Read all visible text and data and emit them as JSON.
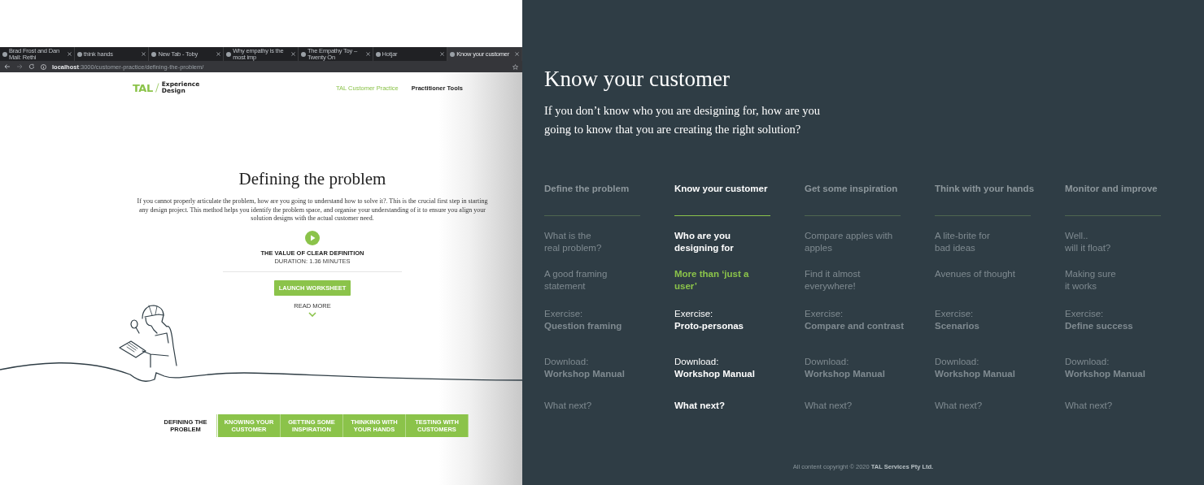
{
  "browser": {
    "tabs": [
      {
        "title": "Brad Frost and Dan Mall: Rethi",
        "selected": false
      },
      {
        "title": "think hands",
        "selected": false
      },
      {
        "title": "New Tab - Toby",
        "selected": false
      },
      {
        "title": "Why empathy is the most imp",
        "selected": false
      },
      {
        "title": "The Empathy Toy – Twenty On",
        "selected": false
      },
      {
        "title": "Hotjar",
        "selected": false
      },
      {
        "title": "Know your customer",
        "selected": true
      }
    ],
    "url": "**localhost**:3000/customer-practice/defining-the-problem/"
  },
  "site": {
    "logo": {
      "mark": "TAL",
      "text": "Experience\nDesign"
    },
    "nav": [
      {
        "label": "TAL Customer Practice",
        "selected": true
      },
      {
        "label": "Practitioner Tools",
        "selected": false
      }
    ],
    "title": "Defining the problem",
    "intro": "If you cannot properly articulate the problem, how are you going to understand how to solve it?. This is the crucial first step in starting any design project. This method helps you identify the problem space, and organise your understanding of it to ensure you align your solution designs with the actual customer need.",
    "video": {
      "title": "THE VALUE OF CLEAR DEFINITION",
      "duration": "DURATION: 1.36 MINUTES"
    },
    "worksheet_button": "LAUNCH WORKSHEET",
    "read_more": "READ MORE",
    "steps": [
      {
        "label": "DEFINING THE\nPROBLEM",
        "selected": true
      },
      {
        "label": "KNOWING YOUR\nCUSTOMER",
        "selected": false
      },
      {
        "label": "GETTING SOME\nINSPIRATION",
        "selected": false
      },
      {
        "label": "THINKING WITH\nYOUR HANDS",
        "selected": false
      },
      {
        "label": "TESTING WITH\nCUSTOMERS",
        "selected": false
      }
    ]
  },
  "panel": {
    "title": "Know your customer",
    "subtitle": "If you don’t know who you are designing for, how are you\ngoing to know that you are creating the right solution?",
    "columns": [
      {
        "heading": "Define the problem",
        "selected": false,
        "items": [
          {
            "kind": "link",
            "text": "What is the\nreal problem?",
            "selected": false
          },
          {
            "kind": "link",
            "text": "A good framing\nstatement",
            "selected": false
          },
          {
            "kind": "exercise",
            "label": "Exercise:",
            "text": "Question framing",
            "selected": false
          },
          {
            "kind": "download",
            "label": "Download:",
            "text": "Workshop Manual",
            "selected": false
          },
          {
            "kind": "link",
            "text": "What next?",
            "selected": false
          }
        ]
      },
      {
        "heading": "Know your customer",
        "selected": true,
        "items": [
          {
            "kind": "link",
            "text": "Who are you\ndesigning for",
            "selected": false
          },
          {
            "kind": "link",
            "text": "More than ‘just a\nuser’",
            "selected": true
          },
          {
            "kind": "exercise",
            "label": "Exercise:",
            "text": "Proto-personas",
            "selected": false
          },
          {
            "kind": "download",
            "label": "Download:",
            "text": "Workshop Manual",
            "selected": false
          },
          {
            "kind": "link",
            "text": "What next?",
            "selected": false
          }
        ]
      },
      {
        "heading": "Get some inspiration",
        "selected": false,
        "items": [
          {
            "kind": "link",
            "text": "Compare apples with\napples",
            "selected": false
          },
          {
            "kind": "link",
            "text": "Find it almost\neverywhere!",
            "selected": false
          },
          {
            "kind": "exercise",
            "label": "Exercise:",
            "text": "Compare and contrast",
            "selected": false
          },
          {
            "kind": "download",
            "label": "Download:",
            "text": "Workshop Manual",
            "selected": false
          },
          {
            "kind": "link",
            "text": "What next?",
            "selected": false
          }
        ]
      },
      {
        "heading": "Think with your hands",
        "selected": false,
        "items": [
          {
            "kind": "link",
            "text": "A lite-brite for\nbad ideas",
            "selected": false
          },
          {
            "kind": "link",
            "text": "Avenues of thought",
            "selected": false
          },
          {
            "kind": "exercise",
            "label": "Exercise:",
            "text": "Scenarios",
            "selected": false
          },
          {
            "kind": "download",
            "label": "Download:",
            "text": "Workshop Manual",
            "selected": false
          },
          {
            "kind": "link",
            "text": "What next?",
            "selected": false
          }
        ]
      },
      {
        "heading": "Monitor and improve",
        "selected": false,
        "items": [
          {
            "kind": "link",
            "text": "Well..\nwill it float?",
            "selected": false
          },
          {
            "kind": "link",
            "text": "Making sure\nit works",
            "selected": false
          },
          {
            "kind": "exercise",
            "label": "Exercise:",
            "text": "Define success",
            "selected": false
          },
          {
            "kind": "download",
            "label": "Download:",
            "text": "Workshop Manual",
            "selected": false
          },
          {
            "kind": "link",
            "text": "What next?",
            "selected": false
          }
        ]
      }
    ],
    "footer": "All content copyright © 2020 **TAL Services Pty Ltd.**"
  }
}
